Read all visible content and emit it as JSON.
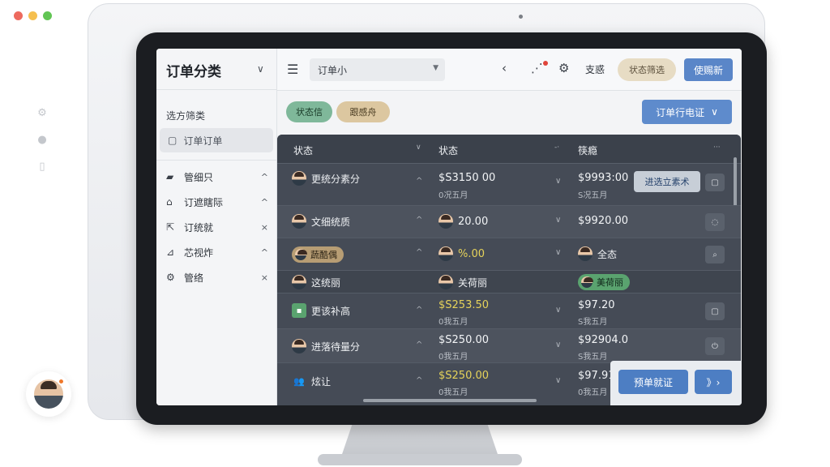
{
  "window": {
    "traffic_lights": [
      "#ed6a5e",
      "#f5bf4f",
      "#61c554"
    ],
    "side_icons": [
      "gear-icon",
      "circle-icon",
      "layout-icon"
    ]
  },
  "sidebar": {
    "title": "订单分类",
    "section_label": "选方筛类",
    "active_item": "订单订单",
    "items": [
      {
        "label": "管细只",
        "icon": "folder-icon",
        "action": "^"
      },
      {
        "label": "订遮瞎际",
        "icon": "bag-icon",
        "action": "^"
      },
      {
        "label": "订统就",
        "icon": "export-icon",
        "action": "×"
      },
      {
        "label": "芯视炸",
        "icon": "box-icon",
        "action": "^"
      },
      {
        "label": "管络",
        "icon": "gear-icon",
        "action": "×"
      }
    ]
  },
  "topbar": {
    "select_value": "订单小",
    "text_link": "支惑",
    "tag_button": "状态筛选",
    "primary_button": "使赐新"
  },
  "filters": {
    "chip_status": "状态信",
    "chip_other": "跟感舟",
    "filter_button": "订单行电证"
  },
  "table": {
    "columns": [
      "状态",
      "状态",
      "筷瘾"
    ],
    "rows": [
      {
        "name": "更统分素分",
        "amount": "$S3150 00",
        "sub1": "0况五月",
        "amount2": "$9993:00",
        "sub2": "S况五月",
        "action": "进选立素术"
      },
      {
        "name": "文细统质",
        "amount": "20.00",
        "sub1": "",
        "amount2": "$9920.00",
        "sub2": ""
      },
      {
        "name": "蔬酷偶",
        "amount": "%.00",
        "sub1": "",
        "amount2": "全态",
        "sub2": ""
      },
      {
        "name": "这统丽",
        "amount": "关荷丽",
        "sub1": "",
        "amount2": "美荷丽",
        "sub2": ""
      },
      {
        "name": "更该补高",
        "amount": "$S253.50",
        "sub1": "0我五月",
        "amount2": "$97.20",
        "sub2": "S我五月"
      },
      {
        "name": "进落待量分",
        "amount": "$S250.00",
        "sub1": "0我五月",
        "amount2": "$92904.0",
        "sub2": "S我五月"
      },
      {
        "name": "炫让",
        "amount": "$S250.00",
        "sub1": "0我五月",
        "amount2": "$97.91",
        "sub2": "0我五月"
      }
    ]
  },
  "float_panel": {
    "primary": "预单就证",
    "secondary": "》›"
  }
}
